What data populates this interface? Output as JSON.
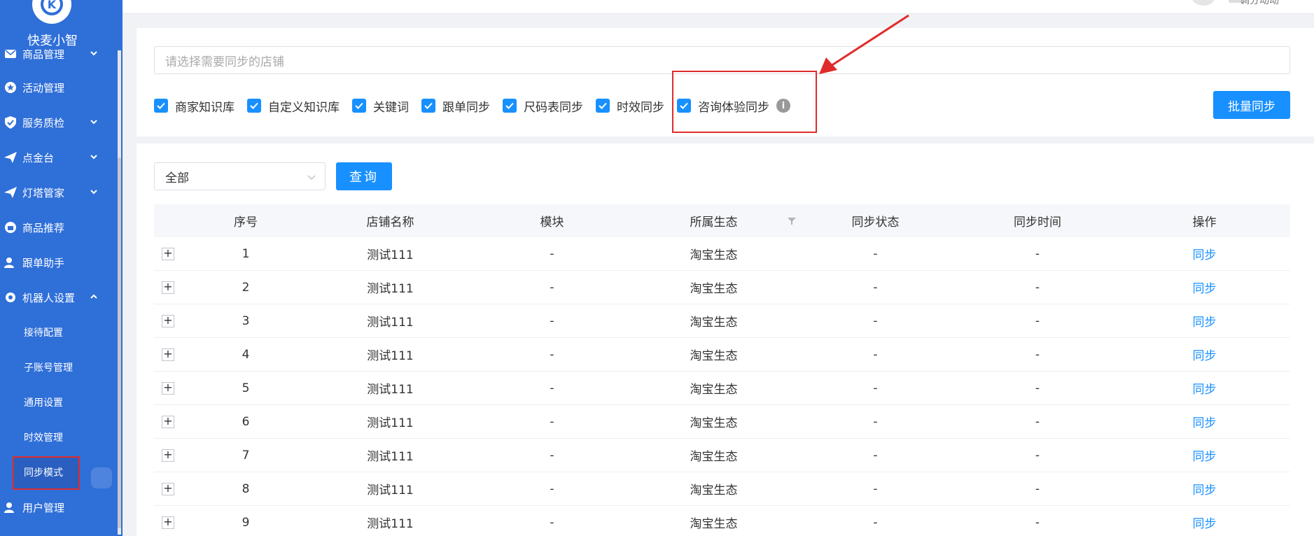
{
  "sidebar": {
    "brand": "快麦小智",
    "logo_letter": "K",
    "items": [
      {
        "label": "商品管理",
        "icon": "mail-icon",
        "has_chevron": true
      },
      {
        "label": "活动管理",
        "icon": "star-icon",
        "has_chevron": false
      },
      {
        "label": "服务质检",
        "icon": "shield-icon",
        "has_chevron": true
      },
      {
        "label": "点金台",
        "icon": "paper-plane-icon",
        "has_chevron": true
      },
      {
        "label": "灯塔管家",
        "icon": "paper-plane-icon",
        "has_chevron": true
      },
      {
        "label": "商品推荐",
        "icon": "gift-icon",
        "has_chevron": false
      },
      {
        "label": "跟单助手",
        "icon": "user-check-icon",
        "has_chevron": false
      },
      {
        "label": "机器人设置",
        "icon": "gear-icon",
        "has_chevron": true,
        "expanded": true
      },
      {
        "label": "用户管理",
        "icon": "user-gear-icon",
        "has_chevron": false
      }
    ],
    "sub_items": [
      "接待配置",
      "子账号管理",
      "通用设置",
      "时效管理",
      "同步模式"
    ],
    "active_sub": "同步模式"
  },
  "topbar": {
    "right_text": "调分动动"
  },
  "sync_panel": {
    "shop_placeholder": "请选择需要同步的店铺",
    "checkboxes": [
      {
        "label": "商家知识库",
        "checked": true
      },
      {
        "label": "自定义知识库",
        "checked": true
      },
      {
        "label": "关键词",
        "checked": true
      },
      {
        "label": "跟单同步",
        "checked": true
      },
      {
        "label": "尺码表同步",
        "checked": true
      },
      {
        "label": "时效同步",
        "checked": true
      },
      {
        "label": "咨询体验同步",
        "checked": true
      }
    ],
    "info_icon": "i",
    "batch_sync_label": "批量同步",
    "accent_color": "#1890ff",
    "highlight_color": "#e02b2b"
  },
  "filter": {
    "selected": "全部",
    "query_label": "查询"
  },
  "table": {
    "headers": [
      "序号",
      "店铺名称",
      "模块",
      "所属生态",
      "同步状态",
      "同步时间",
      "操作"
    ],
    "expand_symbol": "+",
    "rows": [
      {
        "idx": "1",
        "name": "测试111",
        "module": "-",
        "eco": "淘宝生态",
        "status": "-",
        "time": "-",
        "op": "同步"
      },
      {
        "idx": "2",
        "name": "测试111",
        "module": "-",
        "eco": "淘宝生态",
        "status": "-",
        "time": "-",
        "op": "同步"
      },
      {
        "idx": "3",
        "name": "测试111",
        "module": "-",
        "eco": "淘宝生态",
        "status": "-",
        "time": "-",
        "op": "同步"
      },
      {
        "idx": "4",
        "name": "测试111",
        "module": "-",
        "eco": "淘宝生态",
        "status": "-",
        "time": "-",
        "op": "同步"
      },
      {
        "idx": "5",
        "name": "测试111",
        "module": "-",
        "eco": "淘宝生态",
        "status": "-",
        "time": "-",
        "op": "同步"
      },
      {
        "idx": "6",
        "name": "测试111",
        "module": "-",
        "eco": "淘宝生态",
        "status": "-",
        "time": "-",
        "op": "同步"
      },
      {
        "idx": "7",
        "name": "测试111",
        "module": "-",
        "eco": "淘宝生态",
        "status": "-",
        "time": "-",
        "op": "同步"
      },
      {
        "idx": "8",
        "name": "测试111",
        "module": "-",
        "eco": "淘宝生态",
        "status": "-",
        "time": "-",
        "op": "同步"
      },
      {
        "idx": "9",
        "name": "测试111",
        "module": "-",
        "eco": "淘宝生态",
        "status": "-",
        "time": "-",
        "op": "同步"
      }
    ]
  }
}
